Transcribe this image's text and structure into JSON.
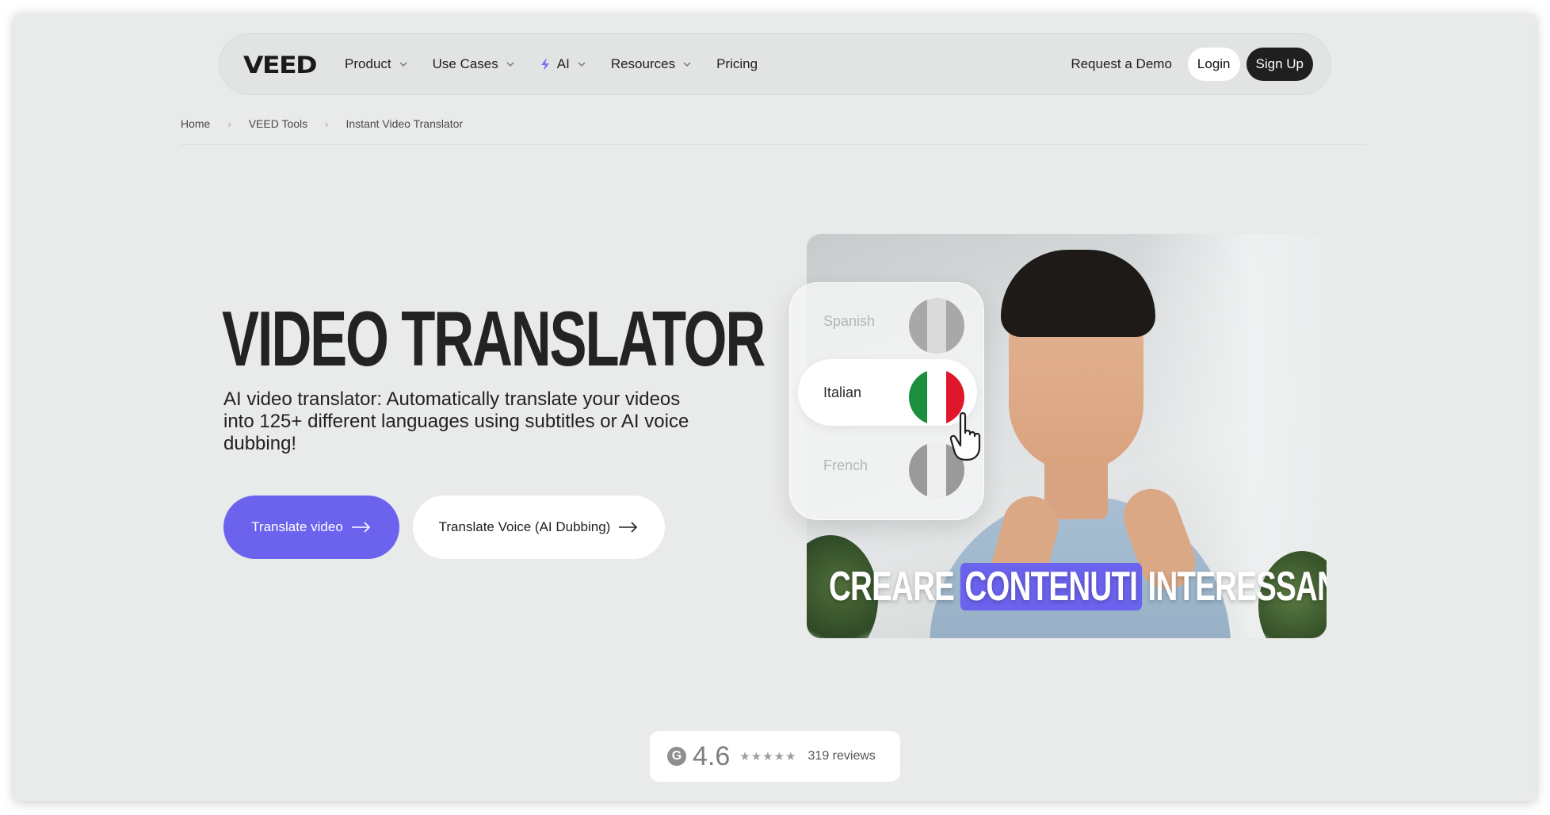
{
  "nav": {
    "logo": "VEED",
    "items": [
      {
        "label": "Product",
        "dropdown": true
      },
      {
        "label": "Use Cases",
        "dropdown": true
      },
      {
        "label": "AI",
        "dropdown": true,
        "icon": "bolt-icon"
      },
      {
        "label": "Resources",
        "dropdown": true
      },
      {
        "label": "Pricing",
        "dropdown": false
      }
    ],
    "request_demo": "Request a Demo",
    "login": "Login",
    "signup": "Sign Up"
  },
  "breadcrumb": [
    "Home",
    "VEED Tools",
    "Instant Video Translator"
  ],
  "hero": {
    "title": "VIDEO TRANSLATOR",
    "subtitle": "AI video translator: Automatically translate your videos into 125+ different languages using subtitles or AI voice dubbing!",
    "primary_cta": "Translate video",
    "secondary_cta": "Translate Voice (AI Dubbing)"
  },
  "video_preview": {
    "languages": [
      {
        "label": "Spanish",
        "state": "dim",
        "flag": [
          "#9a9a9a",
          "#e2e2e2",
          "#9a9a9a"
        ]
      },
      {
        "label": "Italian",
        "state": "active",
        "flag": [
          "#1b8f3e",
          "#ffffff",
          "#e0162b"
        ]
      },
      {
        "label": "French",
        "state": "dim",
        "flag": [
          "#9a9a9a",
          "#eeeeee",
          "#9a9a9a"
        ]
      }
    ],
    "caption": {
      "before": "CREARE",
      "highlight": "CONTENUTI",
      "after": "INTERESSANTI"
    }
  },
  "rating": {
    "source_icon": "g2-icon",
    "score": "4.6",
    "stars": "★★★★★",
    "reviews": "319 reviews"
  },
  "colors": {
    "accent": "#6b63ee",
    "background": "#e9eaea",
    "dark_button": "#1f1f1f"
  }
}
